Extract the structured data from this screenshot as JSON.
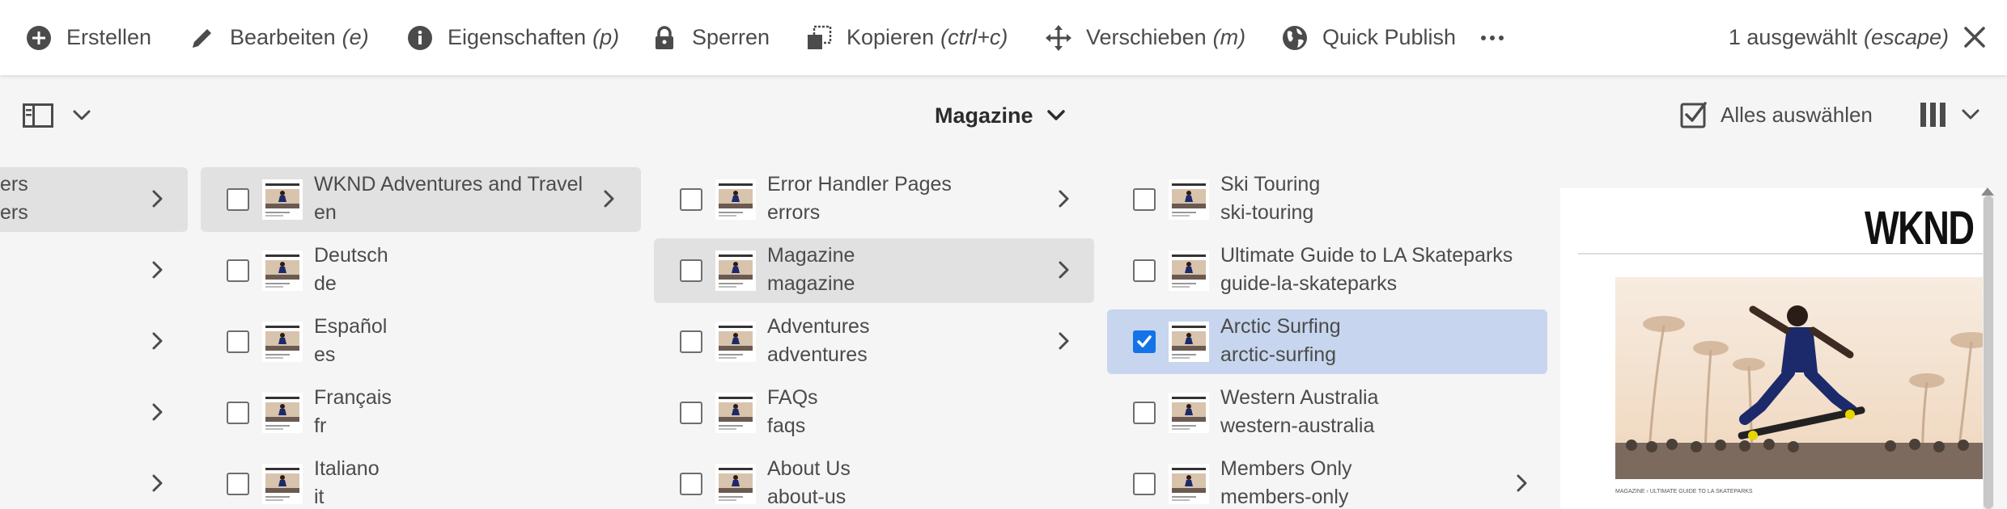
{
  "action_bar": {
    "create": {
      "label": "Erstellen",
      "icon": "add-circle-icon"
    },
    "edit": {
      "label": "Bearbeiten",
      "shortcut": "(e)",
      "icon": "pencil-icon"
    },
    "properties": {
      "label": "Eigenschaften",
      "shortcut": "(p)",
      "icon": "info-icon"
    },
    "lock": {
      "label": "Sperren",
      "icon": "lock-icon"
    },
    "copy": {
      "label": "Kopieren",
      "shortcut": "(ctrl+c)",
      "icon": "copy-icon"
    },
    "move": {
      "label": "Verschieben",
      "shortcut": "(m)",
      "icon": "move-icon"
    },
    "quick_publish": {
      "label": "Quick Publish",
      "icon": "globe-icon"
    },
    "more": {
      "icon": "more-icon"
    },
    "selection": {
      "label": "1 ausgewählt",
      "shortcut": "(escape)",
      "icon": "close-icon"
    }
  },
  "title_bar": {
    "rail_icon": "rail-toggle-icon",
    "title": "Magazine",
    "select_all_label": "Alles auswählen",
    "view_icon": "column-view-icon"
  },
  "columns": [
    {
      "items": [
        {
          "title": "ers",
          "name": "ers",
          "active": true,
          "has_children": true
        },
        {
          "title": "",
          "name": "",
          "has_children": true
        },
        {
          "title": "",
          "name": "",
          "has_children": true
        },
        {
          "title": "",
          "name": "",
          "has_children": true
        },
        {
          "title": "",
          "name": "",
          "has_children": true
        }
      ]
    },
    {
      "items": [
        {
          "title": "WKND Adventures and Travel",
          "name": "en",
          "active": true,
          "has_children": true
        },
        {
          "title": "Deutsch",
          "name": "de"
        },
        {
          "title": "Español",
          "name": "es"
        },
        {
          "title": "Français",
          "name": "fr"
        },
        {
          "title": "Italiano",
          "name": "it"
        }
      ]
    },
    {
      "items": [
        {
          "title": "Error Handler Pages",
          "name": "errors",
          "has_children": true
        },
        {
          "title": "Magazine",
          "name": "magazine",
          "active": true,
          "has_children": true
        },
        {
          "title": "Adventures",
          "name": "adventures",
          "has_children": true
        },
        {
          "title": "FAQs",
          "name": "faqs"
        },
        {
          "title": "About Us",
          "name": "about-us"
        }
      ]
    },
    {
      "items": [
        {
          "title": "Ski Touring",
          "name": "ski-touring"
        },
        {
          "title": "Ultimate Guide to LA Skateparks",
          "name": "guide-la-skateparks"
        },
        {
          "title": "Arctic Surfing",
          "name": "arctic-surfing",
          "selected": true
        },
        {
          "title": "Western Australia",
          "name": "western-australia"
        },
        {
          "title": "Members Only",
          "name": "members-only",
          "has_children": true
        }
      ]
    }
  ],
  "preview": {
    "heading": "WKND S",
    "caption": "MAGAZINE  ›  ULTIMATE GUIDE TO LA SKATEPARKS"
  },
  "colors": {
    "accent": "#1473e6",
    "selected_row": "#c7d6ee",
    "active_row": "#e1e1e1"
  }
}
